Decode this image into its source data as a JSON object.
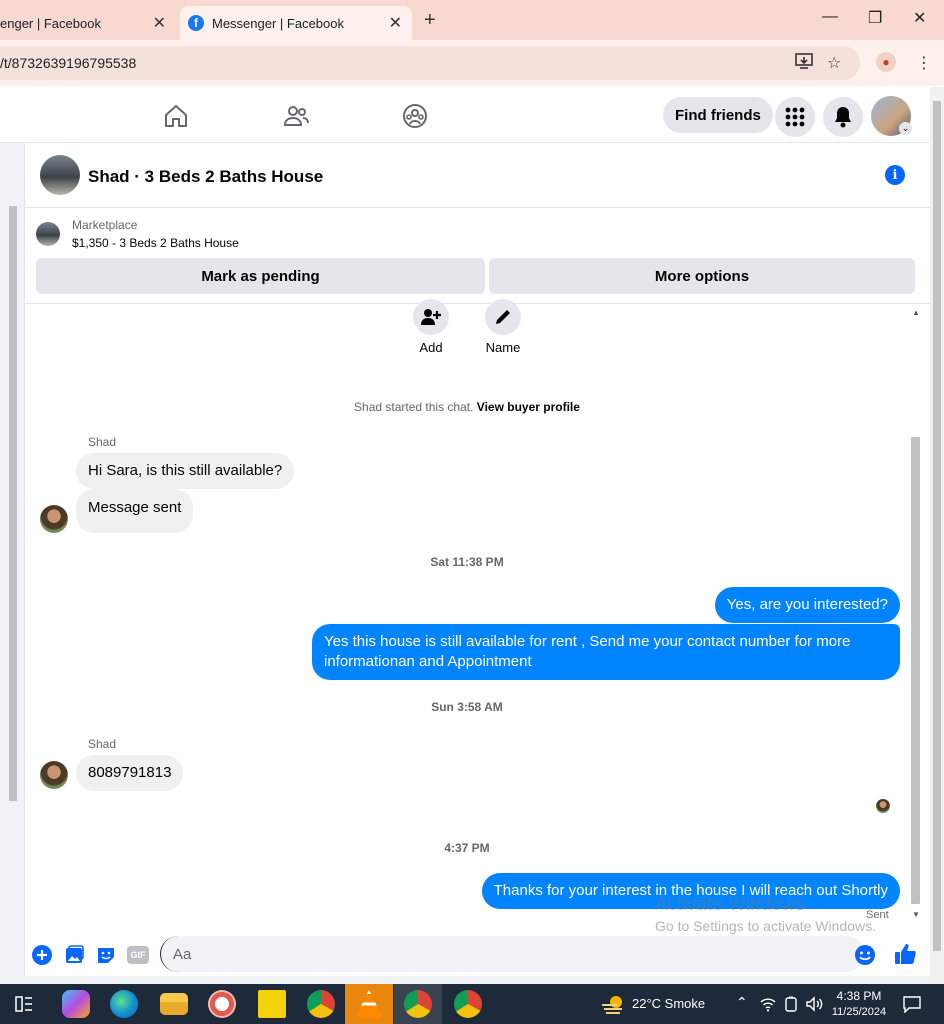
{
  "browser": {
    "tabs": [
      {
        "label": "enger | Facebook",
        "active": false
      },
      {
        "label": "Messenger | Facebook",
        "active": true
      }
    ],
    "url": "/t/8732639196795538"
  },
  "fb_nav": {
    "find_friends": "Find friends"
  },
  "conversation": {
    "title": "Shad · 3 Beds 2 Baths House",
    "marketplace_label": "Marketplace",
    "listing": "$1,350 - 3 Beds 2 Baths House",
    "mark_pending": "Mark as pending",
    "more_options": "More options"
  },
  "actions": {
    "add": "Add",
    "name": "Name"
  },
  "chat": {
    "started_text": "Shad started this chat.",
    "view_profile": "View buyer profile",
    "sender_1": "Shad",
    "msg_1": "Hi Sara, is this still available?",
    "msg_2": "Message sent",
    "stamp_1": "Sat 11:38 PM",
    "msg_3": "Yes, are you interested?",
    "msg_4": "Yes this house is still available for rent , Send me your contact number for more informationan and Appointment",
    "stamp_2": "Sun 3:58 AM",
    "sender_2": "Shad",
    "msg_5": "8089791813",
    "stamp_3": "4:37 PM",
    "msg_6": "Thanks for your interest in the house I will reach out Shortly",
    "sent": "Sent"
  },
  "composer": {
    "placeholder": "Aa",
    "gif_label": "GIF"
  },
  "watermark": {
    "line1": "Activate Windows",
    "line2": "Go to Settings to activate Windows."
  },
  "taskbar": {
    "weather": "22°C  Smoke",
    "time": "4:38 PM",
    "date": "11/25/2024"
  },
  "colors": {
    "fb_blue": "#0866ff",
    "bubble_out": "#0084ff",
    "bubble_in": "#f0f0f0",
    "tab_bg": "#f8d9d2"
  }
}
